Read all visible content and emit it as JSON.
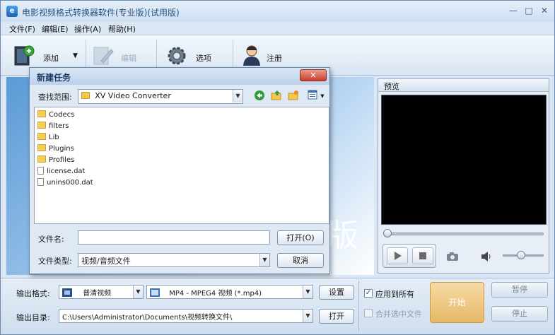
{
  "app": {
    "title": "电影视频格式转换器软件(专业版)(试用版)",
    "icon_letter": "e"
  },
  "menu": [
    "文件(F)",
    "编辑(E)",
    "操作(A)",
    "帮助(H)"
  ],
  "toolbar": {
    "add": "添加",
    "edit": "编辑",
    "options": "选项",
    "register": "注册"
  },
  "workspace": {
    "watermark_char": "版"
  },
  "preview": {
    "title": "预览"
  },
  "bottom": {
    "format_label": "输出格式:",
    "format_category": "普清视频",
    "format_value": "MP4 - MPEG4 视频 (*.mp4)",
    "settings_button": "设置",
    "dir_label": "输出目录:",
    "dir_value": "C:\\Users\\Administrator\\Documents\\视频转换文件\\",
    "open_button": "打开",
    "apply_all": "应用到所有",
    "merge_selected": "合并选中文件",
    "start_button": "开始",
    "pause_button": "暂停",
    "stop_button": "停止"
  },
  "dialog": {
    "title": "新建任务",
    "lookin_label": "查找范围:",
    "lookin_value": "XV Video Converter",
    "files": [
      {
        "name": "Codecs",
        "kind": "folder"
      },
      {
        "name": "filters",
        "kind": "folder"
      },
      {
        "name": "Lib",
        "kind": "folder"
      },
      {
        "name": "Plugins",
        "kind": "folder"
      },
      {
        "name": "Profiles",
        "kind": "folder"
      },
      {
        "name": "license.dat",
        "kind": "file"
      },
      {
        "name": "unins000.dat",
        "kind": "file"
      }
    ],
    "filename_label": "文件名:",
    "filename_value": "",
    "open_button": "打开(O)",
    "filetype_label": "文件类型:",
    "filetype_value": "视频/音频文件",
    "cancel_button": "取消"
  },
  "colors": {
    "accent": "#1d63b5",
    "start_button": "#e6b766",
    "close_button": "#c7402b"
  }
}
